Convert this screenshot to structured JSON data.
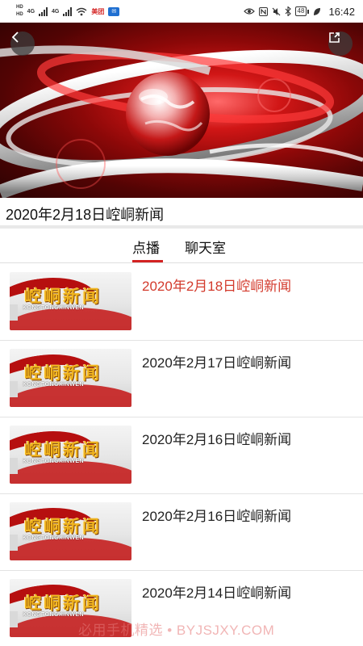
{
  "status_bar": {
    "left_tags": [
      "HD",
      "HD"
    ],
    "net1": "4G",
    "net2": "4G",
    "carrier_badge": "美团",
    "battery": "48",
    "time": "16:42"
  },
  "video": {
    "back_icon": "chevron-left-icon",
    "share_icon": "share-icon"
  },
  "current_title": "2020年2月18日崆峒新闻",
  "tabs": [
    {
      "label": "点播",
      "active": true
    },
    {
      "label": "聊天室",
      "active": false
    }
  ],
  "thumbnail": {
    "logo_text": "崆峒新闻",
    "pinyin": "KONGTONGXINWEN"
  },
  "items": [
    {
      "title": "2020年2月18日崆峒新闻",
      "active": true
    },
    {
      "title": "2020年2月17日崆峒新闻",
      "active": false
    },
    {
      "title": "2020年2月16日崆峒新闻",
      "active": false
    },
    {
      "title": "2020年2月16日崆峒新闻",
      "active": false
    },
    {
      "title": "2020年2月14日崆峒新闻",
      "active": false
    }
  ],
  "watermark": "必用手机精选 • BYJSJXY.COM",
  "colors": {
    "accent": "#d32222",
    "active_title": "#d33a2c"
  }
}
